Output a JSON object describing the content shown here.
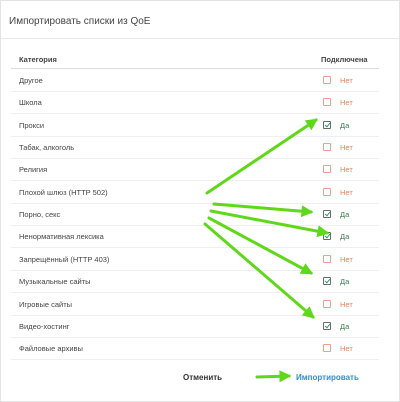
{
  "dialog": {
    "title": "Импортировать списки из QoE"
  },
  "table": {
    "col_category": "Категория",
    "col_connected": "Подключена",
    "rows": [
      {
        "name": "Другое",
        "connected": false,
        "status": "Нет"
      },
      {
        "name": "Школа",
        "connected": false,
        "status": "Нет"
      },
      {
        "name": "Прокси",
        "connected": true,
        "status": "Да"
      },
      {
        "name": "Табак, алкоголь",
        "connected": false,
        "status": "Нет"
      },
      {
        "name": "Религия",
        "connected": false,
        "status": "Нет"
      },
      {
        "name": "Плохой шлюз (HTTP 502)",
        "connected": false,
        "status": "Нет"
      },
      {
        "name": "Порно, секс",
        "connected": true,
        "status": "Да"
      },
      {
        "name": "Ненормативная лексика",
        "connected": true,
        "status": "Да"
      },
      {
        "name": "Запрещённый (HTTP 403)",
        "connected": false,
        "status": "Нет"
      },
      {
        "name": "Музыкальные сайты",
        "connected": true,
        "status": "Да"
      },
      {
        "name": "Игровые сайты",
        "connected": false,
        "status": "Нет"
      },
      {
        "name": "Видео-хостинг",
        "connected": true,
        "status": "Да"
      },
      {
        "name": "Файловые архивы",
        "connected": false,
        "status": "Нет"
      }
    ]
  },
  "footer": {
    "cancel_label": "Отменить",
    "import_label": "Импортировать"
  },
  "colors": {
    "annotation_arrow": "#5fd81a",
    "import_link": "#2a90ce",
    "status_no": "#e4855d",
    "status_yes": "#3d7a4f"
  }
}
